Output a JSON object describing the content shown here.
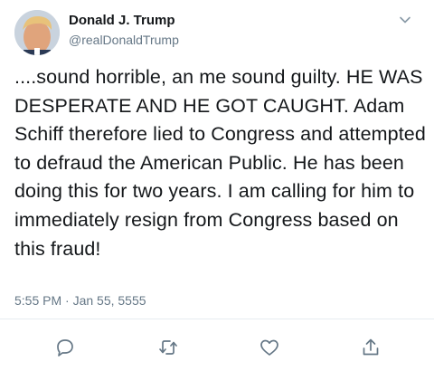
{
  "tweet": {
    "author_name": "Donald J. Trump",
    "author_handle": "@realDonaldTrump",
    "text": "....sound horrible, an me sound guilty. HE WAS DESPERATE AND HE GOT CAUGHT. Adam Schiff therefore lied to Congress and attempted to defraud the American Public. He has been doing this for two years. I am calling for him to immediately resign from Congress based on this fraud!",
    "timestamp": "5:55 PM · Jan 55, 5555"
  },
  "icons": {
    "menu": "chevron-down-icon",
    "reply": "reply-icon",
    "retweet": "retweet-icon",
    "like": "heart-icon",
    "share": "share-icon"
  },
  "colors": {
    "text": "#14171a",
    "secondary": "#657786",
    "divider": "#e6ecf0"
  }
}
